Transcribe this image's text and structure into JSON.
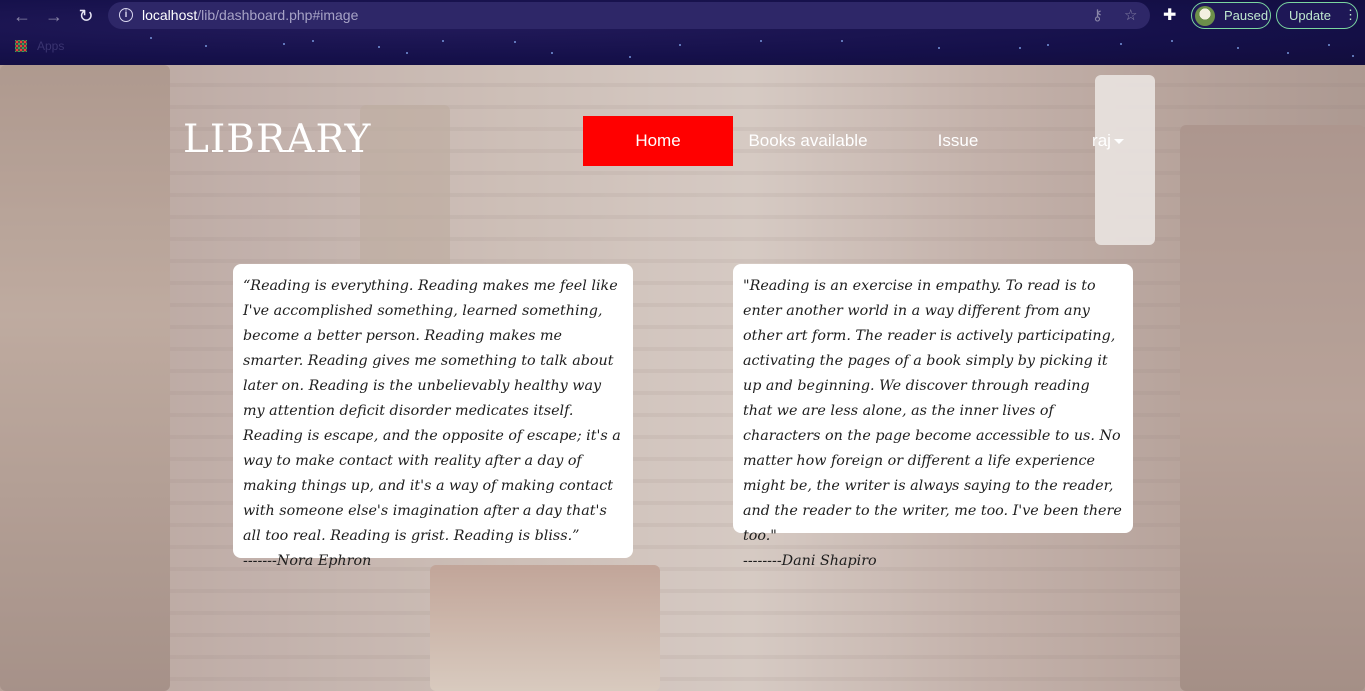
{
  "browser": {
    "url_host": "localhost",
    "url_path": "/lib/dashboard.php#image",
    "profile_status": "Paused",
    "update_label": "Update",
    "bookmarks_apps_label": "Apps"
  },
  "site": {
    "logo": "LIBRARY",
    "nav": {
      "home": "Home",
      "books": "Books available",
      "issue": "Issue",
      "user": "raj"
    }
  },
  "quotes": [
    {
      "text": "“Reading is everything. Reading makes me feel like I've accomplished something, learned something, become a better person. Reading makes me smarter. Reading gives me something to talk about later on. Reading is the unbelievably healthy way my attention deficit disorder medicates itself. Reading is escape, and the opposite of escape; it's a way to make contact with reality after a day of making things up, and it's a way of making contact with someone else's imagination after a day that's all too real. Reading is grist. Reading is bliss.”",
      "author": "-------Nora Ephron"
    },
    {
      "text": "\"Reading is an exercise in empathy. To read is to enter another world in a way different from any other art form. The reader is actively participating, activating the pages of a book simply by picking it up and beginning. We discover through reading that we are less alone, as the inner lives of characters on the page become accessible to us. No matter how foreign or different a life experience might be, the writer is always saying to the reader, and the reader to the writer, me too. I've been there too.\"",
      "author": "--------Dani Shapiro"
    }
  ],
  "colors": {
    "nav_active": "#ff0000",
    "chrome_bg": "#15104a",
    "pill_border": "#7bd6a0"
  }
}
